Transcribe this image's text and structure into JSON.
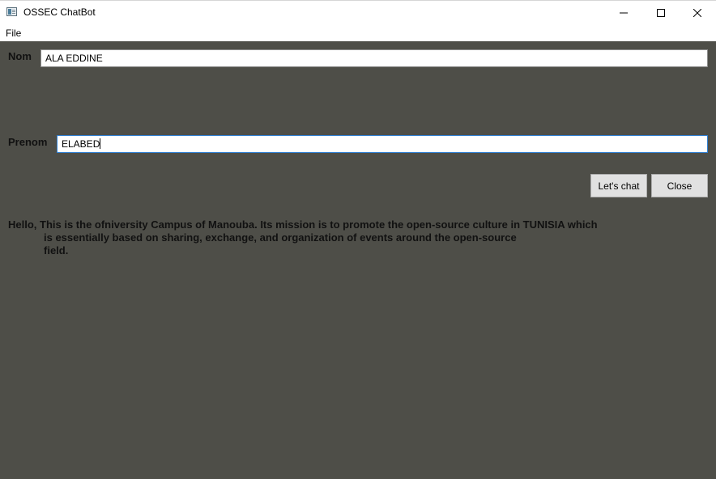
{
  "window": {
    "title": "OSSEC ChatBot",
    "icon": "app-window-icon"
  },
  "menu": {
    "file": "File"
  },
  "form": {
    "nom_label": "Nom",
    "nom_value": "ALA EDDINE",
    "prenom_label": "Prenom",
    "prenom_value": "ELABED"
  },
  "buttons": {
    "chat": "Let's chat",
    "close": "Close"
  },
  "message": {
    "lines": [
      "Hello, This is the ofniversity Campus of Manouba. Its mission is to promote the open-source culture in TUNISIA which",
      "is essentially based on sharing, exchange, and organization of events around the open-source",
      "field."
    ]
  },
  "colors": {
    "background": "#4e4e48",
    "input_focus_border": "#2f7fd3"
  }
}
